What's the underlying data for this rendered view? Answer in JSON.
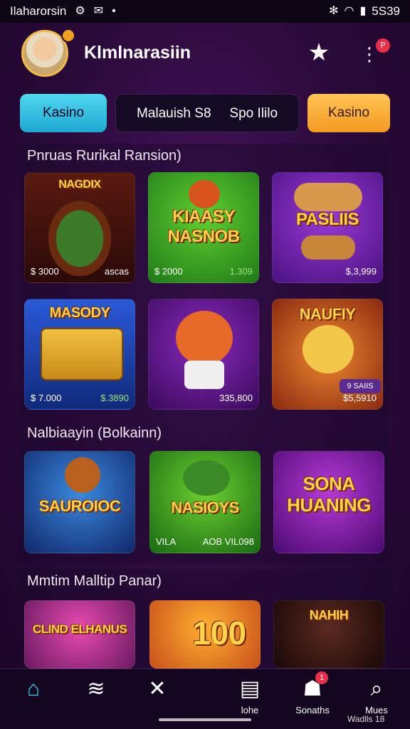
{
  "statusbar": {
    "left_text": "Ilaharorsin",
    "right_text": "5S39"
  },
  "header": {
    "username": "Klmlnarasiin",
    "menu_badge": "P"
  },
  "tabs": [
    {
      "label": "Kasino"
    },
    {
      "label": "Malauish S8",
      "label2": "Spo Ililo"
    },
    {
      "label": "Kasino"
    }
  ],
  "sections": [
    {
      "title": "Pnruas Rurikal Ransion)",
      "cards": [
        {
          "title": "NAGDIX",
          "foot_left": "$ 3000",
          "foot_right": "ascas",
          "theme": "table"
        },
        {
          "title": "KIAASY NASNOB",
          "foot_left": "$ 2000",
          "foot_right": "1.309",
          "theme": "green"
        },
        {
          "title": "PASLIIS",
          "foot_left": "",
          "foot_right": "$,3,999",
          "theme": "purple"
        },
        {
          "title": "MASODY",
          "foot_left": "$ 7.000",
          "foot_right": "$.3890",
          "theme": "slots"
        },
        {
          "title": "",
          "foot_left": "",
          "foot_right": "335,800",
          "theme": "bear"
        },
        {
          "title": "NAUFIY",
          "foot_left": "",
          "foot_right": "$5,5910",
          "theme": "orange",
          "chip": "9 SAIIS"
        }
      ]
    },
    {
      "title": "Nalbiaayin (Bolkainn)",
      "cards": [
        {
          "title": "SAUROIOC",
          "foot_left": "",
          "foot_right": "",
          "theme": "blue"
        },
        {
          "title": "NASIOYS",
          "foot_left": "VILA",
          "foot_right": "AOB VIL098",
          "theme": "green"
        },
        {
          "title": "SONA HUANING",
          "foot_left": "",
          "foot_right": "",
          "theme": "purple"
        }
      ]
    },
    {
      "title": "Mmtim Malltip Panar)",
      "cards": [
        {
          "title": "CLIND ELHANUS",
          "theme": "pink"
        },
        {
          "title": "100",
          "theme": "yellow"
        },
        {
          "title": "NAHIH",
          "theme": "dark"
        }
      ]
    }
  ],
  "bottomnav": [
    {
      "icon": "home-icon",
      "label": ""
    },
    {
      "icon": "wifi-icon",
      "label": ""
    },
    {
      "icon": "tools-icon",
      "label": ""
    },
    {
      "icon": "slot-icon",
      "label": "lohe"
    },
    {
      "icon": "user-icon",
      "label": "Sonaths"
    },
    {
      "icon": "search-icon",
      "label": "Mues"
    }
  ],
  "nav_badge": "1",
  "corner_text": "Wadlls 18"
}
